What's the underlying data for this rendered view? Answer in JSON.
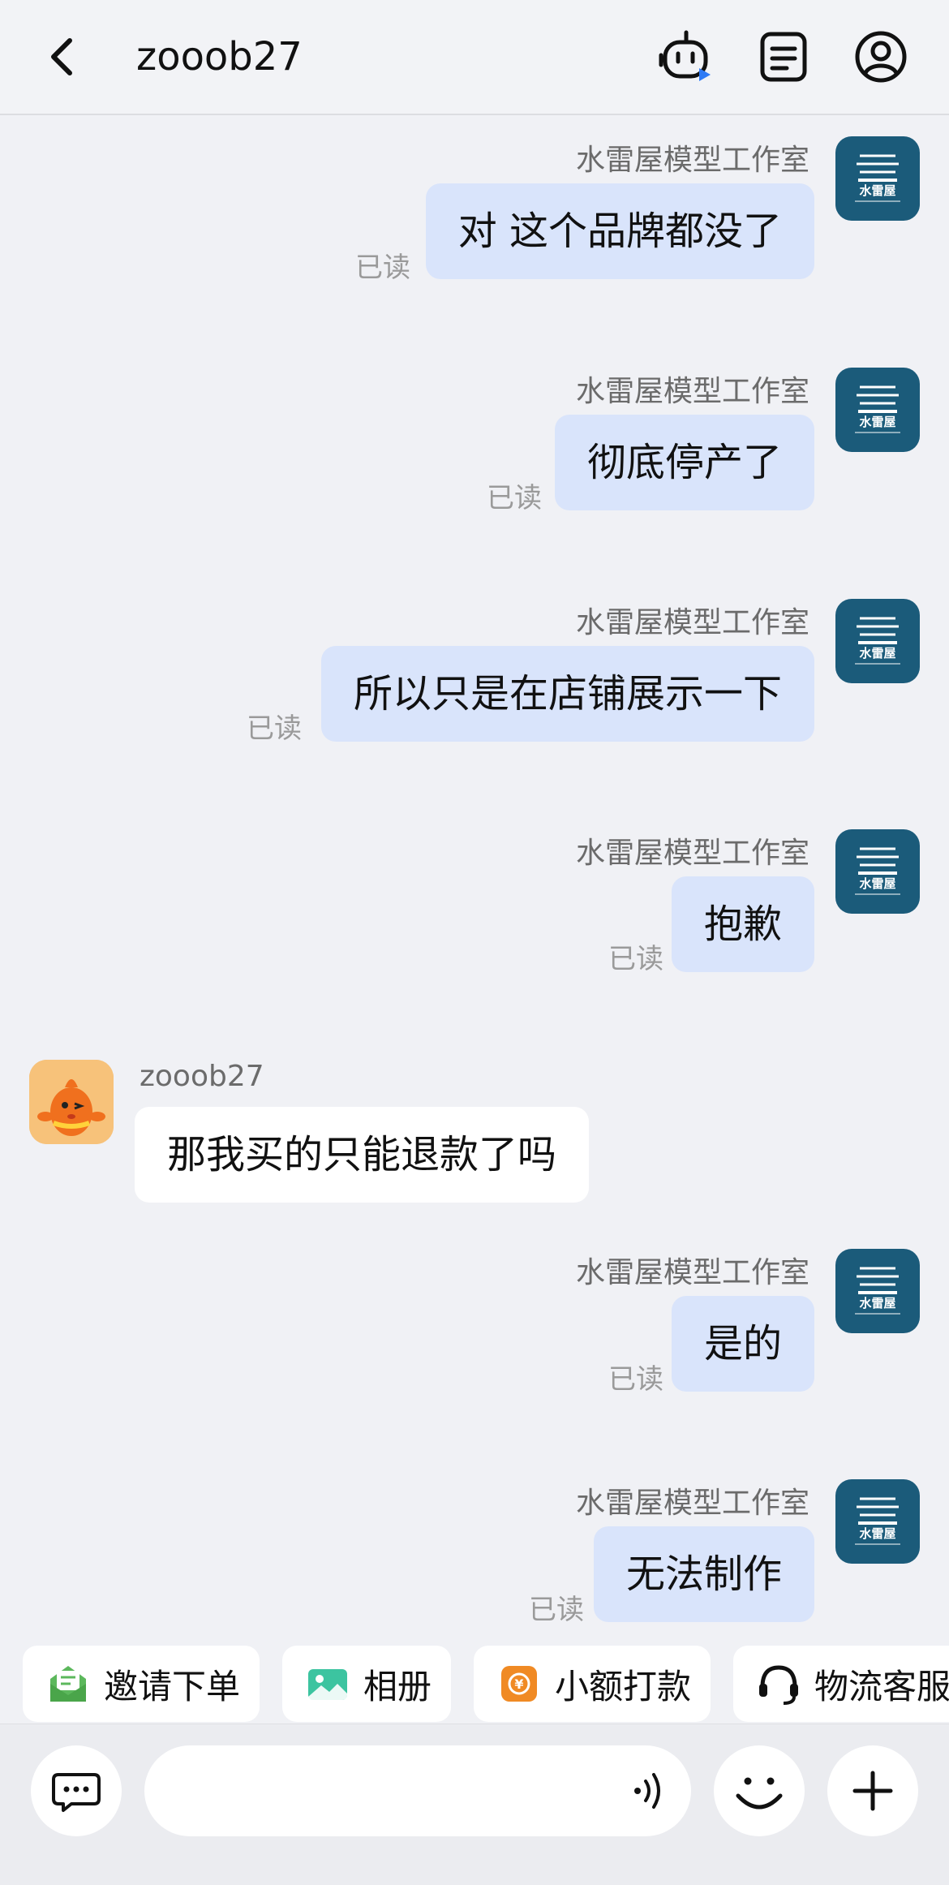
{
  "header": {
    "title": "zooob27",
    "icons": [
      "back-chevron-icon",
      "robot-assistant-icon",
      "order-list-icon",
      "user-profile-icon"
    ]
  },
  "shop_name": "水雷屋模型工作室",
  "user_name": "zooob27",
  "messages": [
    {
      "side": "right",
      "sender": "水雷屋模型工作室",
      "text": "对 这个品牌都没了",
      "status": "已读"
    },
    {
      "side": "right",
      "sender": "水雷屋模型工作室",
      "text": "彻底停产了",
      "status": "已读"
    },
    {
      "side": "right",
      "sender": "水雷屋模型工作室",
      "text": "所以只是在店铺展示一下",
      "status": "已读"
    },
    {
      "side": "right",
      "sender": "水雷屋模型工作室",
      "text": "抱歉",
      "status": "已读"
    },
    {
      "side": "left",
      "sender": "zooob27",
      "text": "那我买的只能退款了吗"
    },
    {
      "side": "right",
      "sender": "水雷屋模型工作室",
      "text": "是的",
      "status": "已读"
    },
    {
      "side": "right",
      "sender": "水雷屋模型工作室",
      "text": "无法制作",
      "status": "已读"
    }
  ],
  "quick_actions": [
    {
      "label": "邀请下单",
      "icon": "invite-order-icon",
      "color": "#5cb85c"
    },
    {
      "label": "相册",
      "icon": "album-icon",
      "color": "#3cc4a0"
    },
    {
      "label": "小额打款",
      "icon": "small-payment-icon",
      "color": "#f08a24"
    },
    {
      "label": "物流客服",
      "icon": "logistics-service-icon",
      "color": "#111111"
    }
  ],
  "input": {
    "placeholder": "",
    "icons": [
      "chat-bubble-icon",
      "voice-icon",
      "emoji-icon",
      "plus-icon"
    ]
  },
  "colors": {
    "bubble_self": "#d9e4fb",
    "bubble_other": "#ffffff",
    "background": "#f0f1f5",
    "shop_avatar": "#1b5b7a"
  }
}
